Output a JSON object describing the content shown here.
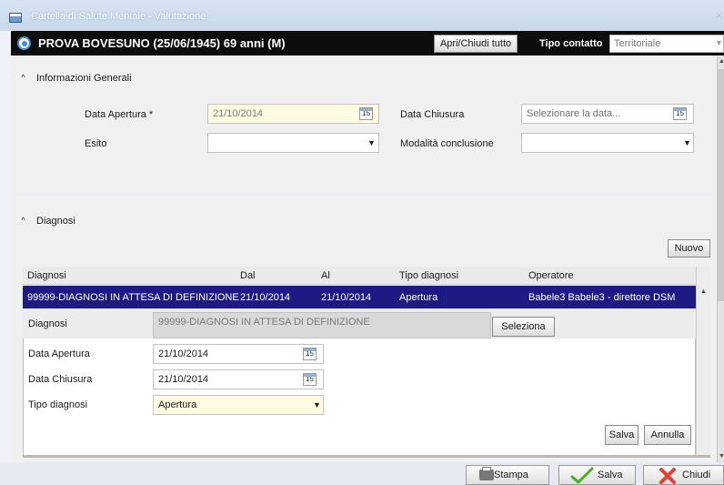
{
  "window": {
    "title": "Cartella di Salute Mentale - Valutazione",
    "close_glyph": "×"
  },
  "header": {
    "patient": "PROVA BOVESUNO (25/06/1945) 69 anni (M)",
    "toggle_all_label": "Apri/Chiudi tutto",
    "tipo_contatto_label": "Tipo contatto",
    "tipo_contatto_value": "Territoriale"
  },
  "general": {
    "title": "Informazioni Generali",
    "data_apertura_label": "Data Apertura *",
    "data_apertura_value": "21/10/2014",
    "data_chiusura_label": "Data Chiusura",
    "data_chiusura_placeholder": "Selezionare la data...",
    "esito_label": "Esito",
    "modalita_label": "Modalità conclusione"
  },
  "diagnosi": {
    "title": "Diagnosi",
    "new_button": "Nuovo",
    "columns": [
      "Diagnosi",
      "Dal",
      "Al",
      "Tipo diagnosi",
      "Operatore"
    ],
    "selected_row": [
      "99999-DIAGNOSI IN ATTESA DI DEFINIZIONE",
      "21/10/2014",
      "21/10/2014",
      "Apertura",
      "Babele3 Babele3 - direttore DSM"
    ],
    "detail": {
      "diagnosi_label": "Diagnosi",
      "diagnosi_value": "99999-DIAGNOSI IN ATTESA DI DEFINIZIONE",
      "seleziona": "Seleziona",
      "data_apertura_label": "Data Apertura",
      "data_apertura_value": "21/10/2014",
      "data_chiusura_label": "Data Chiusura",
      "data_chiusura_value": "21/10/2014",
      "tipo_label": "Tipo diagnosi",
      "tipo_value": "Apertura",
      "salva": "Salva",
      "annulla": "Annulla"
    }
  },
  "footer": {
    "stampa": "Stampa",
    "salva": "Salva",
    "chiudi": "Chiudi"
  },
  "icons": {
    "calendar_text": "15",
    "collapse": "^",
    "caret": "▼"
  },
  "colors": {
    "header_bg": "#0d0d0d",
    "selected_row_bg": "#1e1a84",
    "required_field_bg": "#fffbe1",
    "accent": "#3d8fe0"
  }
}
